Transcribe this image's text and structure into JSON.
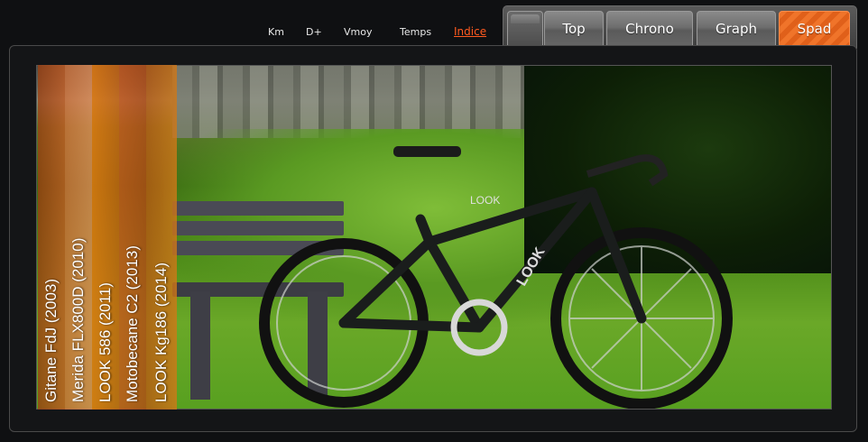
{
  "subnav": {
    "items": [
      {
        "label": "Km",
        "active": false
      },
      {
        "label": "D+",
        "active": false
      },
      {
        "label": "Vmoy",
        "active": false
      },
      {
        "label": "Temps",
        "active": false
      },
      {
        "label": "Indice",
        "active": true
      }
    ],
    "active_color": "#ff5a1f"
  },
  "tabs": [
    {
      "label": "Top",
      "active": false
    },
    {
      "label": "Chrono",
      "active": false
    },
    {
      "label": "Graph",
      "active": false
    },
    {
      "label": "Spad",
      "active": true
    }
  ],
  "bikes": [
    {
      "label": "Gitane FdJ (2003)",
      "color": "#b5521e"
    },
    {
      "label": "Merida FLX800D (2010)",
      "color": "#d0703a"
    },
    {
      "label": "LOOK 586 (2011)",
      "color": "#d86a10"
    },
    {
      "label": "Motobecane C2 (2013)",
      "color": "#c9561a"
    },
    {
      "label": "LOOK Kg186 (2014)",
      "color": "#c46a14"
    }
  ],
  "photo": {
    "brand_text": "LOOK"
  }
}
